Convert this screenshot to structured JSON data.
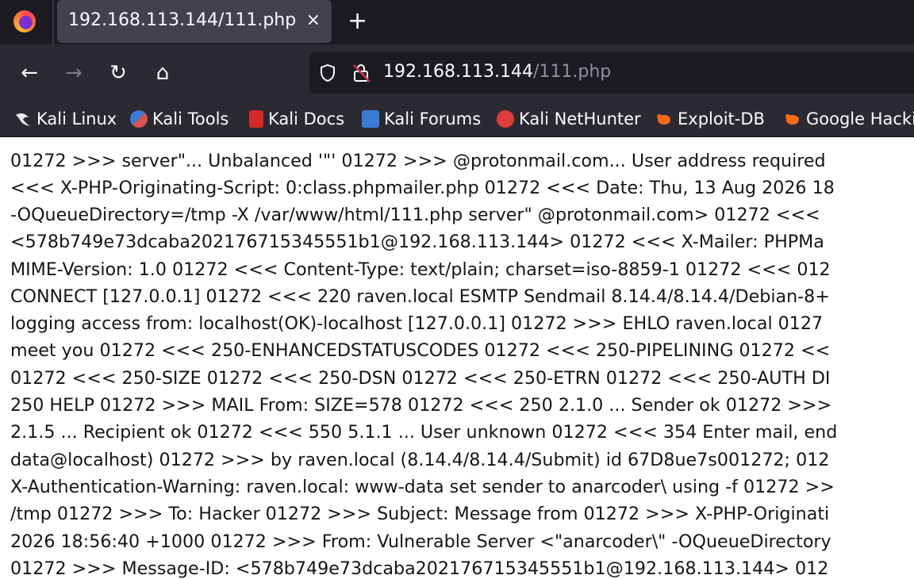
{
  "tab": {
    "title": "192.168.113.144/111.php",
    "close": "×"
  },
  "new_tab": "+",
  "nav": {
    "back": "←",
    "forward": "→",
    "reload": "↻",
    "home": "⌂"
  },
  "url": {
    "host": "192.168.113.144",
    "path": "/111.php"
  },
  "bookmarks": [
    {
      "label": "Kali Linux",
      "icon_color": "#2e8bd8"
    },
    {
      "label": "Kali Tools",
      "icon_color": "#d9534f"
    },
    {
      "label": "Kali Docs",
      "icon_color": "#d62828"
    },
    {
      "label": "Kali Forums",
      "icon_color": "#3a7bd5"
    },
    {
      "label": "Kali NetHunter",
      "icon_color": "#e23b3b"
    },
    {
      "label": "Exploit-DB",
      "icon_color": "#ff6a13"
    },
    {
      "label": "Google Hacki",
      "icon_color": "#ff6a13"
    }
  ],
  "content_lines": [
    "01272 >>> server\"... Unbalanced '\"' 01272 >>> @protonmail.com... User address required",
    "<<< X-PHP-Originating-Script: 0:class.phpmailer.php 01272 <<< Date: Thu, 13 Aug 2026 18",
    "-OQueueDirectory=/tmp -X /var/www/html/111.php server\" @protonmail.com> 01272 <<< ",
    "<578b749e73dcaba202176715345551b1@192.168.113.144> 01272 <<< X-Mailer: PHPMa",
    "MIME-Version: 1.0 01272 <<< Content-Type: text/plain; charset=iso-8859-1 01272 <<< 012",
    "CONNECT [127.0.0.1] 01272 <<< 220 raven.local ESMTP Sendmail 8.14.4/8.14.4/Debian-8+",
    "logging access from: localhost(OK)-localhost [127.0.0.1] 01272 >>> EHLO raven.local 0127",
    "meet you 01272 <<< 250-ENHANCEDSTATUSCODES 01272 <<< 250-PIPELINING 01272 <<",
    "01272 <<< 250-SIZE 01272 <<< 250-DSN 01272 <<< 250-ETRN 01272 <<< 250-AUTH DI",
    "250 HELP 01272 >>> MAIL From: SIZE=578 01272 <<< 250 2.1.0 ... Sender ok 01272 >>>",
    "2.1.5 ... Recipient ok 01272 <<< 550 5.1.1 ... User unknown 01272 <<< 354 Enter mail, end",
    "data@localhost) 01272 >>> by raven.local (8.14.4/8.14.4/Submit) id 67D8ue7s001272; 012",
    "X-Authentication-Warning: raven.local: www-data set sender to anarcoder\\ using -f 01272 >>",
    "/tmp 01272 >>> To: Hacker 01272 >>> Subject: Message from 01272 >>> X-PHP-Originati",
    "2026 18:56:40 +1000 01272 >>> From: Vulnerable Server <\"anarcoder\\\" -OQueueDirectory",
    "01272 >>> Message-ID: <578b749e73dcaba202176715345551b1@192.168.113.144> 012"
  ]
}
